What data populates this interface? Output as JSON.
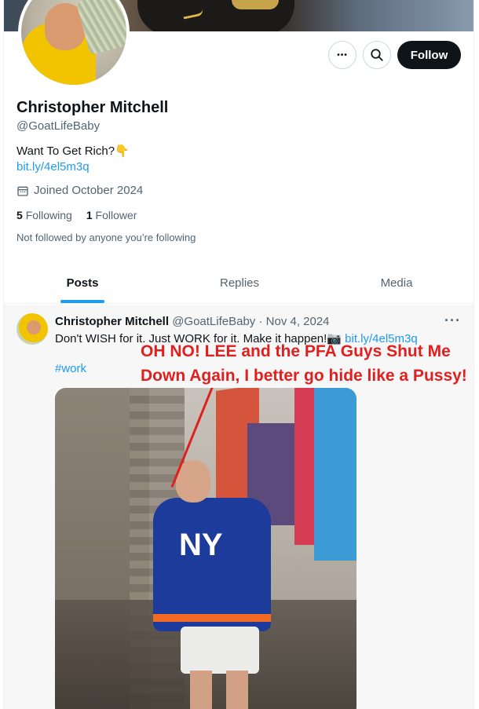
{
  "profile": {
    "name": "Christopher Mitchell",
    "handle": "@GoatLifeBaby",
    "bio": "Want To Get Rich?👇",
    "link": "bit.ly/4el5m3q",
    "joined": "Joined October 2024",
    "following_count": "5",
    "following_label": "Following",
    "followers_count": "1",
    "followers_label": "Follower",
    "not_followed": "Not followed by anyone you’re following"
  },
  "actions": {
    "more_label": "•••",
    "follow_label": "Follow"
  },
  "tabs": [
    {
      "label": "Posts",
      "active": true
    },
    {
      "label": "Replies",
      "active": false
    },
    {
      "label": "Media",
      "active": false
    }
  ],
  "tweet": {
    "name": "Christopher Mitchell",
    "meta": "@GoatLifeBaby · Nov 4, 2024",
    "more": "···",
    "text": "Don't WISH for it. Just WORK for it. Make it happen!📷",
    "link": "bit.ly/4el5m3q",
    "hashtag": "#work",
    "photo_jersey_text": "NY"
  },
  "overlay": {
    "line1": "OH NO! LEE and the PFA Guys Shut Me",
    "line2": "Down Again, I better go hide like a Pussy!"
  },
  "colors": {
    "accent": "#1d9bf0",
    "overlay_text": "#e01f1f"
  }
}
